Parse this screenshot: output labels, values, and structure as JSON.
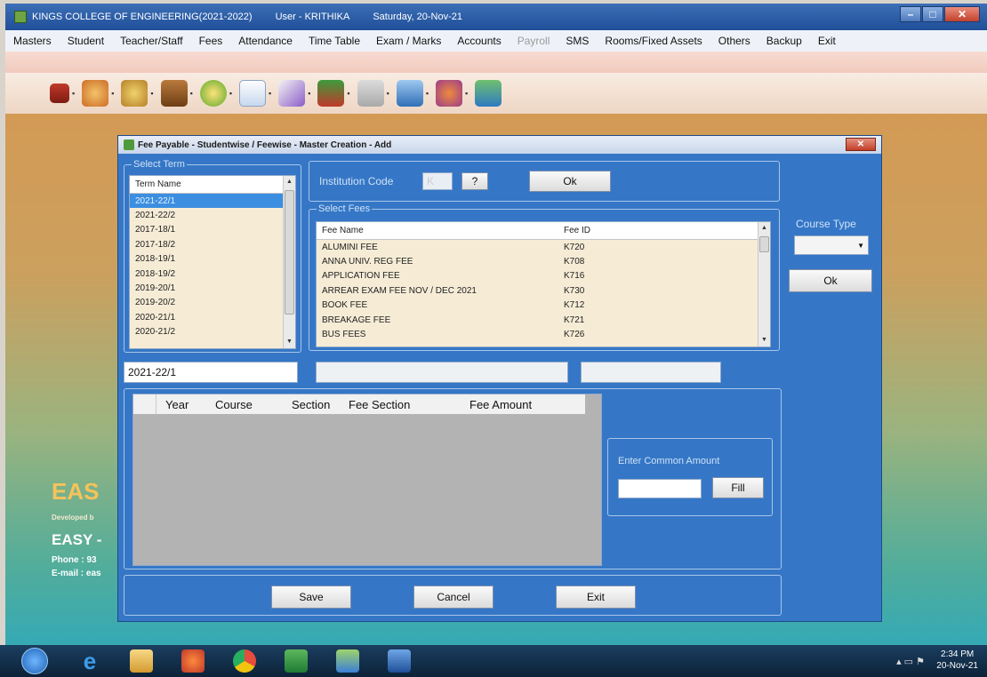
{
  "window": {
    "title": "KINGS COLLEGE OF ENGINEERING(2021-2022)",
    "user": "User - KRITHIKA",
    "date": "Saturday, 20-Nov-21"
  },
  "menu": [
    "Masters",
    "Student",
    "Teacher/Staff",
    "Fees",
    "Attendance",
    "Time Table",
    "Exam / Marks",
    "Accounts",
    "Payroll",
    "SMS",
    "Rooms/Fixed Assets",
    "Others",
    "Backup",
    "Exit"
  ],
  "brand": {
    "easy": "EAS",
    "developed": "Developed b",
    "easy2": "EASY -",
    "phone": "Phone : 93",
    "email": "E-mail : eas"
  },
  "dialog": {
    "title": "Fee Payable - Studentwise / Feewise - Master Creation - Add",
    "select_term_label": "Select Term",
    "term_header": "Term Name",
    "terms": [
      "2021-22/1",
      "2021-22/2",
      "2017-18/1",
      "2017-18/2",
      "2018-19/1",
      "2018-19/2",
      "2019-20/1",
      "2019-20/2",
      "2020-21/1",
      "2020-21/2"
    ],
    "selected_term": "2021-22/1",
    "institution_code_label": "Institution Code",
    "institution_code_value": "K",
    "help_label": "?",
    "ok_label": "Ok",
    "select_fees_label": "Select Fees",
    "fee_headers": [
      "Fee Name",
      "Fee ID"
    ],
    "fees": [
      {
        "name": "ALUMINI FEE",
        "id": "K720"
      },
      {
        "name": "ANNA UNIV. REG FEE",
        "id": "K708"
      },
      {
        "name": "APPLICATION FEE",
        "id": "K716"
      },
      {
        "name": "ARREAR EXAM FEE NOV / DEC 2021",
        "id": "K730"
      },
      {
        "name": "BOOK FEE",
        "id": "K712"
      },
      {
        "name": "BREAKAGE FEE",
        "id": "K721"
      },
      {
        "name": "BUS FEES",
        "id": "K726"
      }
    ],
    "course_type_label": "Course Type",
    "course_type_value": "",
    "course_ok_label": "Ok",
    "term_text": "2021-22/1",
    "grid_headers": [
      "Year",
      "Course",
      "Section",
      "Fee Section",
      "Fee Amount"
    ],
    "common_amount_label": "Enter Common Amount",
    "fill_label": "Fill",
    "save_label": "Save",
    "cancel_label": "Cancel",
    "exit_label": "Exit"
  },
  "taskbar": {
    "time": "2:34 PM",
    "date": "20-Nov-21"
  }
}
